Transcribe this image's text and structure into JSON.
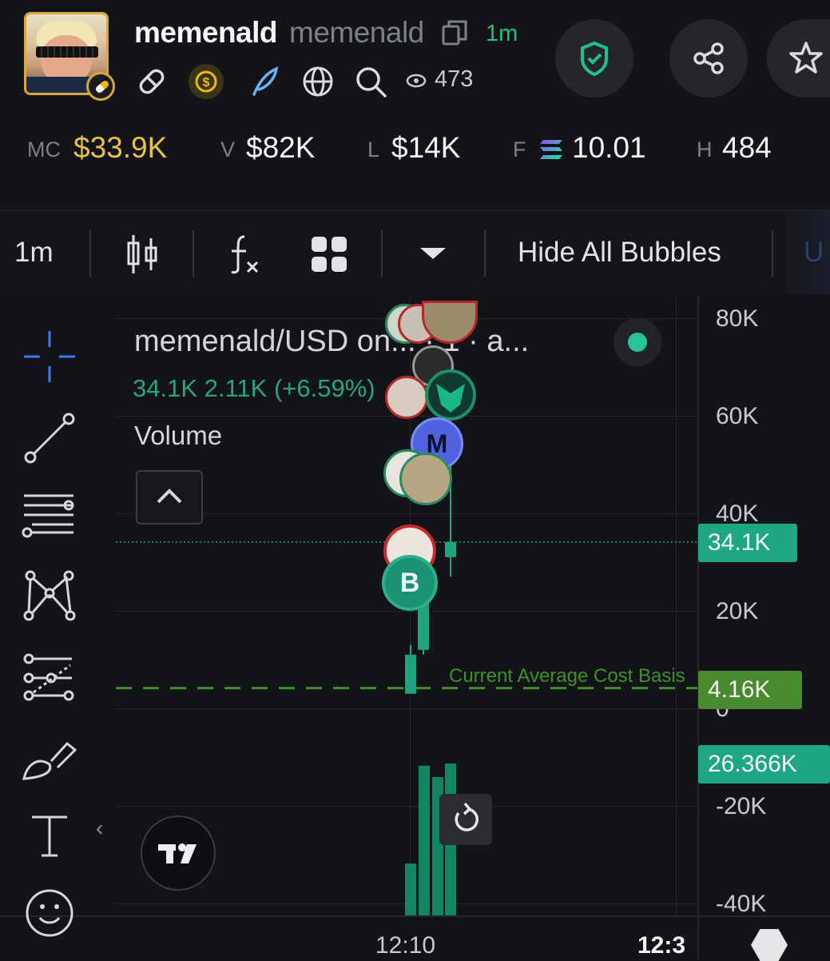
{
  "header": {
    "token_name": "memenald",
    "token_ticker": "memenald",
    "age": "1m",
    "views": "473",
    "icons": [
      "link-icon",
      "dollar-coin-icon",
      "feather-icon",
      "globe-icon",
      "search-icon",
      "eye-icon"
    ],
    "actions": [
      "shield-check-icon",
      "share-icon",
      "star-icon"
    ]
  },
  "stats": [
    {
      "key": "MC",
      "value": "$33.9K",
      "color": "#e8c14a"
    },
    {
      "key": "V",
      "value": "$82K",
      "color": "#f5f6f7"
    },
    {
      "key": "L",
      "value": "$14K",
      "color": "#f5f6f7"
    },
    {
      "key": "F",
      "value": "10.01",
      "color": "#f5f6f7",
      "icon": "solana-icon"
    },
    {
      "key": "H",
      "value": "484",
      "color": "#f5f6f7"
    }
  ],
  "toolbar": {
    "interval": "1m",
    "hide_bubbles": "Hide All Bubbles",
    "cut_label": "U",
    "icons": [
      "candlestick-icon",
      "indicators-icon",
      "layout-grid-icon",
      "chevron-down-icon"
    ]
  },
  "tools": [
    "crosshair-icon",
    "trendline-icon",
    "fib-icon",
    "pattern-icon",
    "projection-icon",
    "brush-icon",
    "text-icon",
    "emoji-icon"
  ],
  "chart": {
    "legend_title": "memenald/USD on... · 1 · a...",
    "legend_values": "34.1K  2.11K (+6.59%)",
    "volume_label": "Volume",
    "cost_basis_label": "Current Average Cost Basis",
    "price_tag": "34.1K",
    "cost_basis_tag": "4.16K",
    "volume_tag": "26.366K",
    "bubble_labels": [
      "M",
      "B"
    ],
    "colors": {
      "up": "#1fa37f",
      "cost_basis": "#3f8f2e",
      "tag_green": "#1ea784",
      "tag_cost": "#4a8a2e"
    }
  },
  "chart_data": {
    "type": "candlestick",
    "y_ticks": [
      "80K",
      "60K",
      "40K",
      "20K",
      "0",
      "-20K",
      "-40K"
    ],
    "x_ticks": [
      "12:10",
      "12:3"
    ],
    "ylim": [
      -40000,
      80000
    ],
    "candles": [
      {
        "open": 3000,
        "close": 11000,
        "high": 13000,
        "low": 3000
      },
      {
        "open": 12000,
        "close": 30000,
        "high": 32000,
        "low": 11000
      },
      {
        "open": 31000,
        "close": 34100,
        "high": 50000,
        "low": 27000
      }
    ],
    "volume": [
      9000,
      26000,
      24000,
      26366
    ],
    "last_price": 34100,
    "avg_cost_basis": 4160
  }
}
